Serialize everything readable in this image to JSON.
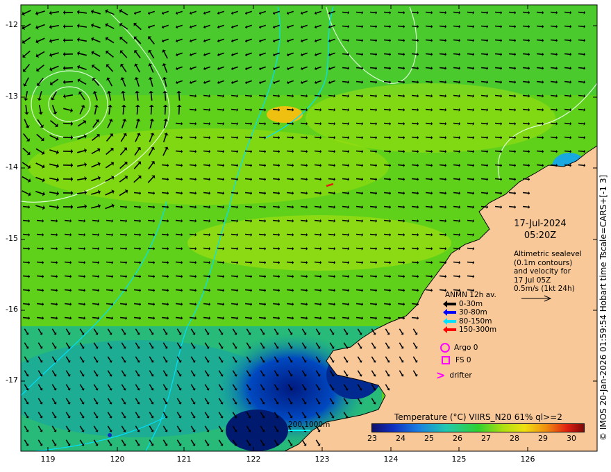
{
  "map": {
    "lat_ticks": [
      "-12",
      "-13",
      "-14",
      "-15",
      "-16",
      "-17"
    ],
    "lon_ticks": [
      "119",
      "120",
      "121",
      "122",
      "123",
      "124",
      "125",
      "126"
    ],
    "colors": {
      "land": "#f8c898",
      "ocean_warm": "#6fd800",
      "ocean_cool": "#19b66a",
      "coastal_cold": "#003ca0",
      "contour": "#e8ffe8",
      "isobath": "#00e0ff",
      "vector": "#000000"
    }
  },
  "side_credit": "© IMOS 20-Jan-2026 01:59:54 Hobart time Tscale=CARS+[-1 3]",
  "datetime": {
    "date": "17-Jul-2024",
    "time": "05:20Z"
  },
  "altimetry_note": {
    "lines": [
      "Altimetric sealevel",
      "(0.1m contours)",
      "and velocity for",
      "17 Jul 05Z",
      "0.5m/s (1kt 24h)"
    ]
  },
  "anmn": {
    "title": "ANMN 12h av.",
    "rows": [
      {
        "label": "0-30m",
        "color": "#000000"
      },
      {
        "label": "30-80m",
        "color": "#0000ff"
      },
      {
        "label": "80-150m",
        "color": "#00e0ff"
      },
      {
        "label": "150-300m",
        "color": "#ff0000"
      }
    ]
  },
  "symbols": {
    "argo": "Argo 0",
    "fs": "FS 0",
    "drifter": "drifter"
  },
  "isobath_label": "200  1000m",
  "colorbar": {
    "title": "Temperature (°C) VIIRS_N20 61% ql>=2",
    "ticks": [
      "23",
      "24",
      "25",
      "26",
      "27",
      "28",
      "29",
      "30"
    ]
  }
}
